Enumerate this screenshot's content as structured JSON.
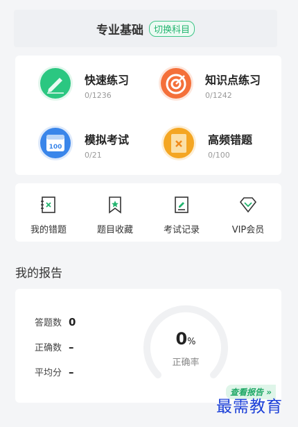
{
  "header": {
    "title": "专业基础",
    "switch_label": "切换科目"
  },
  "practice": [
    {
      "title": "快速练习",
      "count": "0/1236",
      "icon": "pencil-icon",
      "color": "#2bc781"
    },
    {
      "title": "知识点练习",
      "count": "0/1242",
      "icon": "target-icon",
      "color": "#f4703a"
    },
    {
      "title": "模拟考试",
      "count": "0/21",
      "icon": "calendar-icon",
      "color": "#3a86ea"
    },
    {
      "title": "高频错题",
      "count": "0/100",
      "icon": "error-book-icon",
      "color": "#f4a623"
    }
  ],
  "tools": [
    {
      "label": "我的错题",
      "icon": "wrong-book-icon"
    },
    {
      "label": "题目收藏",
      "icon": "bookmark-star-icon"
    },
    {
      "label": "考试记录",
      "icon": "exam-record-icon"
    },
    {
      "label": "VIP会员",
      "icon": "diamond-icon"
    }
  ],
  "report": {
    "section_title": "我的报告",
    "stats": [
      {
        "label": "答题数",
        "value": "0"
      },
      {
        "label": "正确数",
        "value": "–"
      },
      {
        "label": "平均分",
        "value": "–"
      }
    ],
    "accuracy_value": "0",
    "accuracy_unit": "%",
    "accuracy_label": "正确率",
    "view_report_label": "查看报告 »"
  },
  "watermark": "最需教育",
  "colors": {
    "accent": "#22b46f",
    "watermark": "#1b3fd8"
  }
}
